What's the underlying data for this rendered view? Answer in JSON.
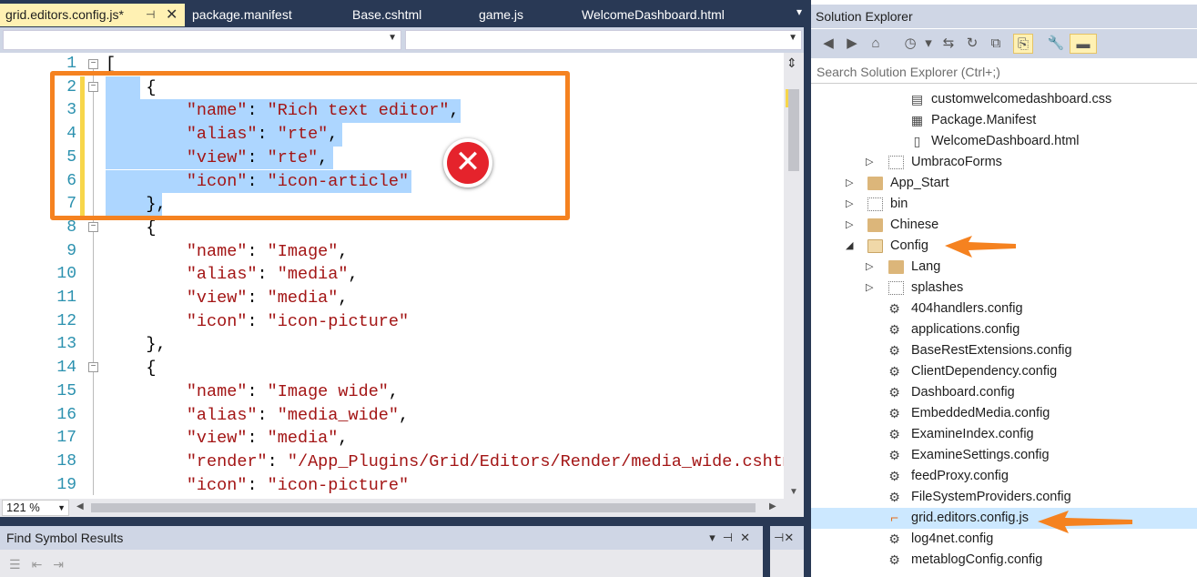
{
  "tabs": [
    {
      "label": "grid.editors.config.js*",
      "active": true
    },
    {
      "label": "package.manifest",
      "active": false
    },
    {
      "label": "Base.cshtml",
      "active": false
    },
    {
      "label": "game.js",
      "active": false
    },
    {
      "label": "WelcomeDashboard.html",
      "active": false
    }
  ],
  "editor": {
    "line_numbers": [
      "1",
      "2",
      "3",
      "4",
      "5",
      "6",
      "7",
      "8",
      "9",
      "10",
      "11",
      "12",
      "13",
      "14",
      "15",
      "16",
      "17",
      "18",
      "19"
    ],
    "code": {
      "l1": "[",
      "l2": "    {",
      "l3k": "\"name\"",
      "l3v": "\"Rich text editor\"",
      "l4k": "\"alias\"",
      "l4v": "\"rte\"",
      "l5k": "\"view\"",
      "l5v": "\"rte\"",
      "l6k": "\"icon\"",
      "l6v": "\"icon-article\"",
      "l7": "    },",
      "l8": "    {",
      "l9k": "\"name\"",
      "l9v": "\"Image\"",
      "l10k": "\"alias\"",
      "l10v": "\"media\"",
      "l11k": "\"view\"",
      "l11v": "\"media\"",
      "l12k": "\"icon\"",
      "l12v": "\"icon-picture\"",
      "l13": "    },",
      "l14": "    {",
      "l15k": "\"name\"",
      "l15v": "\"Image wide\"",
      "l16k": "\"alias\"",
      "l16v": "\"media_wide\"",
      "l17k": "\"view\"",
      "l17v": "\"media\"",
      "l18k": "\"render\"",
      "l18v": "\"/App_Plugins/Grid/Editors/Render/media_wide.cshtml",
      "l19k": "\"icon\"",
      "l19v": "\"icon-picture\""
    },
    "zoom": "121 %",
    "error_symbol": "✕"
  },
  "find_panel": {
    "title": "Find Symbol Results"
  },
  "solution_explorer": {
    "title": "Solution Explorer",
    "search_placeholder": "Search Solution Explorer (Ctrl+;)",
    "items": [
      {
        "label": "customwelcomedashboard.css",
        "icon": "css-file-icon"
      },
      {
        "label": "Package.Manifest",
        "icon": "manifest-file-icon"
      },
      {
        "label": "WelcomeDashboard.html",
        "icon": "html-file-icon"
      },
      {
        "label": "UmbracoForms",
        "icon": "hidden-folder-icon"
      },
      {
        "label": "App_Start",
        "icon": "folder-icon"
      },
      {
        "label": "bin",
        "icon": "hidden-folder-icon"
      },
      {
        "label": "Chinese",
        "icon": "folder-icon"
      },
      {
        "label": "Config",
        "icon": "open-folder-icon"
      },
      {
        "label": "Lang",
        "icon": "folder-icon"
      },
      {
        "label": "splashes",
        "icon": "hidden-folder-icon"
      },
      {
        "label": "404handlers.config",
        "icon": "config-file-icon"
      },
      {
        "label": "applications.config",
        "icon": "config-file-icon"
      },
      {
        "label": "BaseRestExtensions.config",
        "icon": "config-file-icon"
      },
      {
        "label": "ClientDependency.config",
        "icon": "config-file-icon"
      },
      {
        "label": "Dashboard.config",
        "icon": "config-file-icon"
      },
      {
        "label": "EmbeddedMedia.config",
        "icon": "config-file-icon"
      },
      {
        "label": "ExamineIndex.config",
        "icon": "config-file-icon"
      },
      {
        "label": "ExamineSettings.config",
        "icon": "config-file-icon"
      },
      {
        "label": "feedProxy.config",
        "icon": "config-file-icon"
      },
      {
        "label": "FileSystemProviders.config",
        "icon": "config-file-icon"
      },
      {
        "label": "grid.editors.config.js",
        "icon": "js-file-icon"
      },
      {
        "label": "log4net.config",
        "icon": "config-file-icon"
      },
      {
        "label": "metablogConfig.config",
        "icon": "config-file-icon"
      }
    ]
  },
  "colors": {
    "accent_orange": "#f58220",
    "error_red": "#e5232c",
    "selection_blue": "#add6ff",
    "string_red": "#a31515",
    "line_number_teal": "#2b91af"
  }
}
